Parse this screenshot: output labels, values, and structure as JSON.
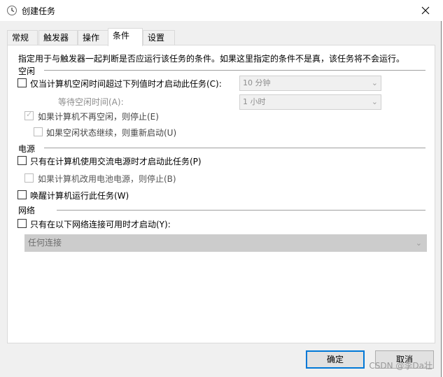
{
  "window": {
    "title": "创建任务"
  },
  "tabs": [
    "常规",
    "触发器",
    "操作",
    "条件",
    "设置"
  ],
  "description": "指定用于与触发器一起判断是否应运行该任务的条件。如果这里指定的条件不是真，该任务将不会运行。",
  "idle": {
    "group_label": "空闲",
    "start_only_if_idle": "仅当计算机空闲时间超过下列值时才启动此任务(C):",
    "idle_duration_value": "10 分钟",
    "wait_for_idle_label": "等待空闲时间(A):",
    "wait_for_idle_value": "1 小时",
    "stop_if_not_idle": "如果计算机不再空闲，则停止(E)",
    "restart_if_idle_resumes": "如果空闲状态继续，则重新启动(U)"
  },
  "power": {
    "group_label": "电源",
    "start_only_on_ac": "只有在计算机使用交流电源时才启动此任务(P)",
    "stop_if_battery": "如果计算机改用电池电源，则停止(B)",
    "wake_to_run": "唤醒计算机运行此任务(W)"
  },
  "network": {
    "group_label": "网络",
    "start_only_if_network": "只有在以下网络连接可用时才启动(Y):",
    "connection_value": "任何连接"
  },
  "buttons": {
    "ok": "确定",
    "cancel": "取消"
  },
  "watermark": "CSDN @李Da壮",
  "colors": {
    "accent": "#0078d7",
    "panel_bg": "#ffffff",
    "window_bg": "#f0f0f0"
  }
}
